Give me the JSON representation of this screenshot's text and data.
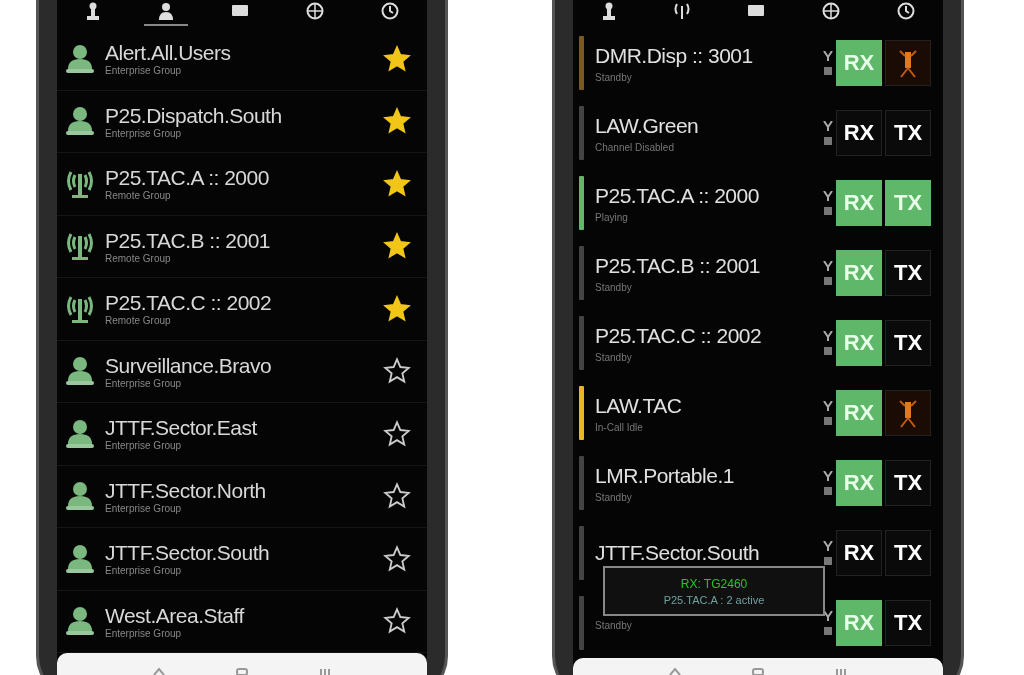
{
  "phones": [
    {
      "tabs": [
        {
          "kind": "pawn",
          "selected": false
        },
        {
          "kind": "person",
          "selected": true
        },
        {
          "kind": "monitor",
          "selected": false
        },
        {
          "kind": "globe",
          "selected": false
        },
        {
          "kind": "clock",
          "selected": false
        }
      ],
      "groups": [
        {
          "kind": "enterprise",
          "name": "Alert.All.Users",
          "type": "Enterprise Group",
          "favorite": true
        },
        {
          "kind": "enterprise",
          "name": "P25.Dispatch.South",
          "type": "Enterprise Group",
          "favorite": true
        },
        {
          "kind": "remote",
          "name": "P25.TAC.A :: 2000",
          "type": "Remote Group",
          "favorite": true
        },
        {
          "kind": "remote",
          "name": "P25.TAC.B :: 2001",
          "type": "Remote Group",
          "favorite": true
        },
        {
          "kind": "remote",
          "name": "P25.TAC.C :: 2002",
          "type": "Remote Group",
          "favorite": true
        },
        {
          "kind": "enterprise",
          "name": "Surveillance.Bravo",
          "type": "Enterprise Group",
          "favorite": false
        },
        {
          "kind": "enterprise",
          "name": "JTTF.Sector.East",
          "type": "Enterprise Group",
          "favorite": false
        },
        {
          "kind": "enterprise",
          "name": "JTTF.Sector.North",
          "type": "Enterprise Group",
          "favorite": false
        },
        {
          "kind": "enterprise",
          "name": "JTTF.Sector.South",
          "type": "Enterprise Group",
          "favorite": false
        },
        {
          "kind": "enterprise",
          "name": "West.Area.Staff",
          "type": "Enterprise Group",
          "favorite": false
        }
      ]
    },
    {
      "tabs": [
        {
          "kind": "pawn",
          "selected": false
        },
        {
          "kind": "antenna",
          "selected": false
        },
        {
          "kind": "monitor",
          "selected": false
        },
        {
          "kind": "globe",
          "selected": false
        },
        {
          "kind": "clock",
          "selected": false
        }
      ],
      "channels": [
        {
          "name": "DMR.Disp :: 3001",
          "status": "Standby",
          "color": "#7a5a20",
          "rx": {
            "label": "RX",
            "active": true
          },
          "tx": {
            "kind": "icon"
          }
        },
        {
          "name": "LAW.Green",
          "status": "Channel Disabled",
          "color": "#444444",
          "rx": {
            "label": "RX",
            "active": false
          },
          "tx": {
            "kind": "button",
            "label": "TX",
            "active": false
          }
        },
        {
          "name": "P25.TAC.A :: 2000",
          "status": "Playing",
          "color": "#5fb86a",
          "rx": {
            "label": "RX",
            "active": true
          },
          "tx": {
            "kind": "button",
            "label": "TX",
            "active": true
          }
        },
        {
          "name": "P25.TAC.B :: 2001",
          "status": "Standby",
          "color": "#444444",
          "rx": {
            "label": "RX",
            "active": true
          },
          "tx": {
            "kind": "button",
            "label": "TX",
            "active": false
          }
        },
        {
          "name": "P25.TAC.C :: 2002",
          "status": "Standby",
          "color": "#444444",
          "rx": {
            "label": "RX",
            "active": true
          },
          "tx": {
            "kind": "button",
            "label": "TX",
            "active": false
          }
        },
        {
          "name": "LAW.TAC",
          "status": "In-Call Idle",
          "color": "#f0b323",
          "rx": {
            "label": "RX",
            "active": true
          },
          "tx": {
            "kind": "icon"
          }
        },
        {
          "name": "LMR.Portable.1",
          "status": "Standby",
          "color": "#444444",
          "rx": {
            "label": "RX",
            "active": true
          },
          "tx": {
            "kind": "button",
            "label": "TX",
            "active": false
          }
        },
        {
          "name": "JTTF.Sector.South",
          "color": "#444444",
          "rx": {
            "label": "RX",
            "active": false
          },
          "tx": {
            "kind": "button",
            "label": "TX",
            "active": false
          }
        },
        {
          "status": "Standby",
          "color": "#444444",
          "rx": {
            "label": "RX",
            "active": true
          },
          "tx": {
            "kind": "button",
            "label": "TX",
            "active": false
          }
        }
      ],
      "toast": {
        "title": "RX: TG2460",
        "detail": "P25.TAC.A : 2 active"
      }
    }
  ]
}
